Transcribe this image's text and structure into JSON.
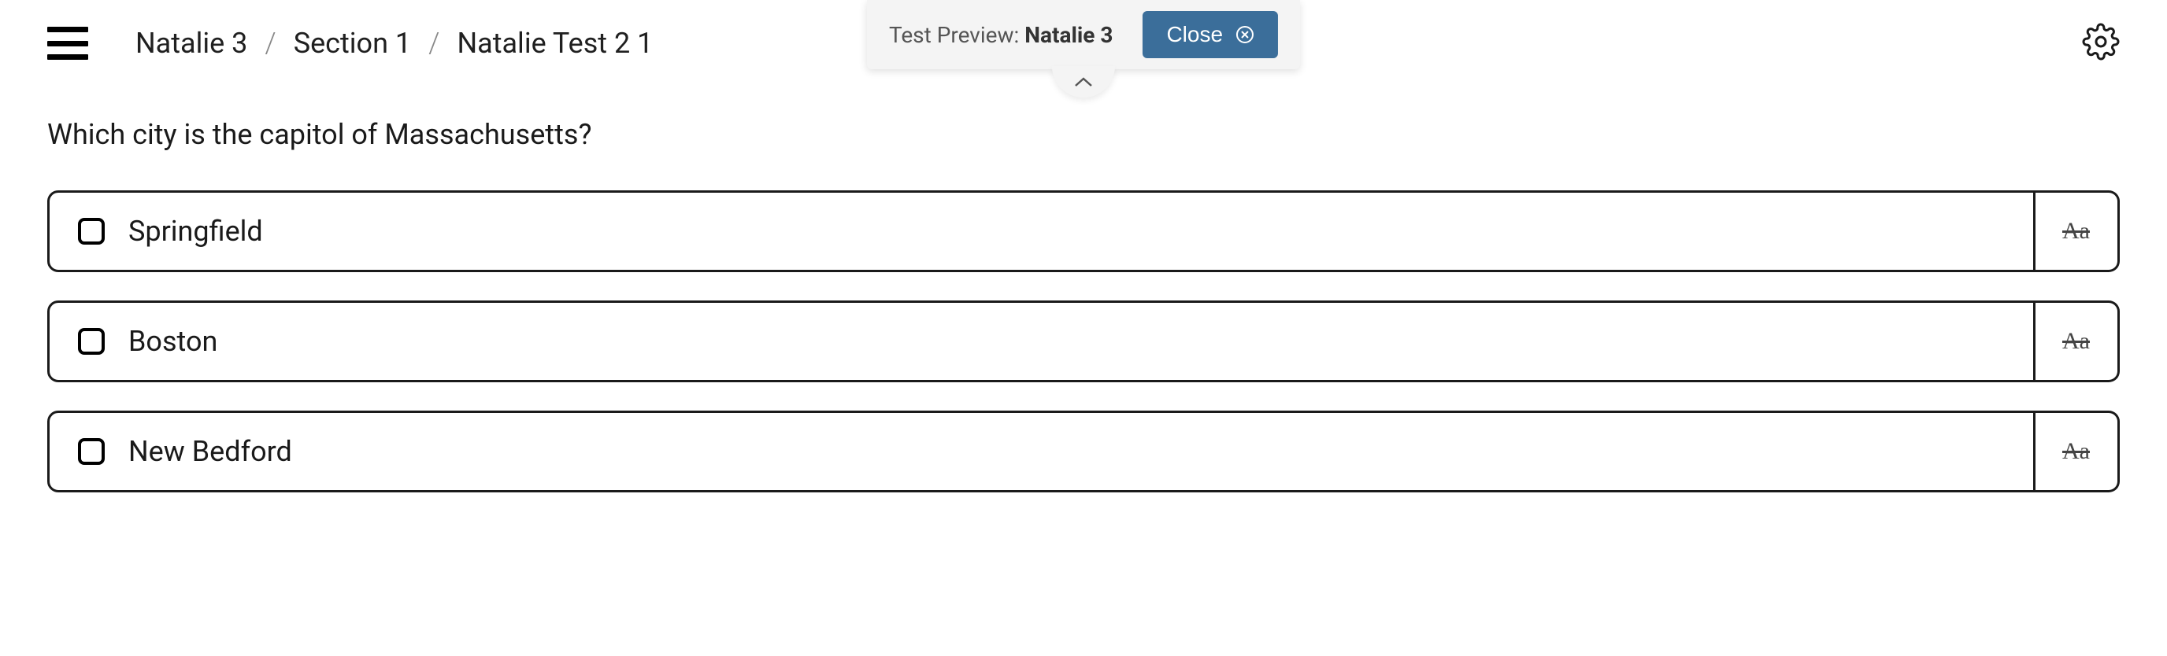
{
  "preview": {
    "label": "Test Preview: ",
    "name": "Natalie 3",
    "close_label": "Close"
  },
  "breadcrumb": {
    "item1": "Natalie 3",
    "item2": "Section 1",
    "item3": "Natalie Test 2 1",
    "sep": "/"
  },
  "question": {
    "text": "Which city is the capitol of Massachusetts?"
  },
  "options": [
    {
      "label": "Springfield",
      "strike": "Aa"
    },
    {
      "label": "Boston",
      "strike": "Aa"
    },
    {
      "label": "New Bedford",
      "strike": "Aa"
    }
  ]
}
